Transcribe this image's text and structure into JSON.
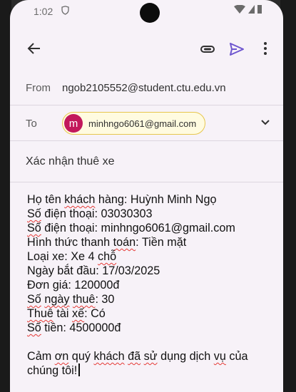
{
  "status_bar": {
    "time": "1:02"
  },
  "header": {
    "from_label": "From",
    "from_value": "ngob2105552@student.ctu.edu.vn",
    "to_label": "To",
    "to_chip": {
      "initial": "m",
      "email": "minhngo6061@gmail.com"
    }
  },
  "subject": "Xác nhận thuê xe",
  "body": {
    "line1_a": "Họ tên ",
    "line1_b": "khách",
    "line1_c": " hàng: Huỳnh Minh Ngọ",
    "line2_a": "Số",
    "line2_b": " điện thoại: 03030303",
    "line3_a": "Số",
    "line3_b": " điện thoại: minhngo6061@gmail.com",
    "line4_a": "Hình thức thanh ",
    "line4_b": "toán",
    "line4_c": ": Tiền mặt",
    "line5_a": "Loại xe: Xe 4 ",
    "line5_b": "chỗ",
    "line6": "Ngày bắt đầu: 17/03/2025",
    "line7": "Đơn giá: 120000đ",
    "line8_a": "Số",
    "line8_b": " ",
    "line8_c": "ngày",
    "line8_d": " ",
    "line8_e": "thuê",
    "line8_f": ": 30",
    "line9_a": "Thuê",
    "line9_b": " tài ",
    "line9_c": "xế",
    "line9_d": ": Có",
    "line10_a": "Số",
    "line10_b": " tiền: 4500000đ",
    "closing_a": "Cảm ",
    "closing_b": "ơn",
    "closing_c": " quý ",
    "closing_d": "khách",
    "closing_e": " ",
    "closing_f": "đã",
    "closing_g": " ",
    "closing_h": "sử",
    "closing_i": " dụng dịch ",
    "closing_j": "vụ",
    "closing_k": " của",
    "closing2": "chúng tôi!"
  },
  "colors": {
    "accent": "#6e56cf",
    "avatar": "#c2185b",
    "chip_border": "#e7c64d"
  },
  "icons": [
    "back-arrow-icon",
    "attachment-icon",
    "send-icon",
    "more-vert-icon",
    "expand-icon"
  ]
}
